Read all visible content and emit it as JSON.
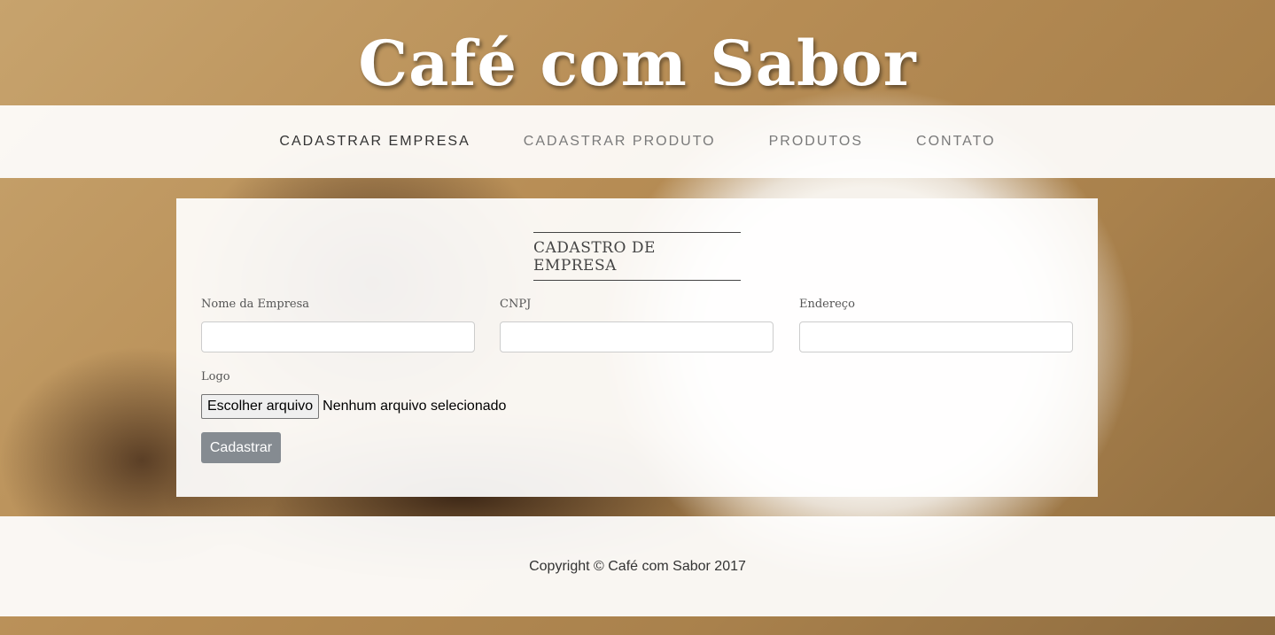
{
  "header": {
    "title": "Café com Sabor"
  },
  "nav": {
    "items": [
      {
        "label": "CADASTRAR EMPRESA"
      },
      {
        "label": "CADASTRAR PRODUTO"
      },
      {
        "label": "PRODUTOS"
      },
      {
        "label": "CONTATO"
      }
    ]
  },
  "form": {
    "title": "CADASTRO DE EMPRESA",
    "fields": {
      "nome": {
        "label": "Nome da Empresa",
        "value": ""
      },
      "cnpj": {
        "label": "CNPJ",
        "value": ""
      },
      "endereco": {
        "label": "Endereço",
        "value": ""
      }
    },
    "logo": {
      "label": "Logo",
      "button_label": "Escolher arquivo",
      "status": "Nenhum arquivo selecionado"
    },
    "submit_label": "Cadastrar"
  },
  "footer": {
    "text": "Copyright © Café com Sabor 2017"
  },
  "colors": {
    "nav_active": "#333333",
    "nav_inactive": "#7a7a7a",
    "submit_button": "#858b91"
  }
}
